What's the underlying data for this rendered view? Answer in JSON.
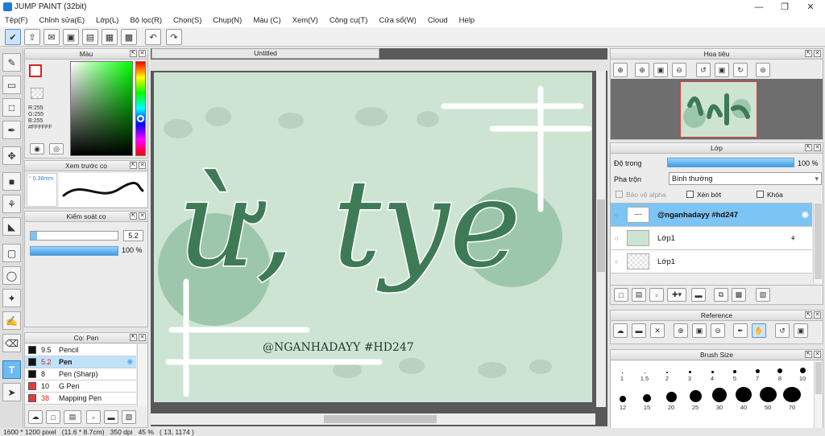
{
  "window": {
    "title": "JUMP PAINT (32bit)"
  },
  "menu": [
    "Tệp(F)",
    "Chỉnh sửa(E)",
    "Lớp(L)",
    "Bộ lọc(R)",
    "Chọn(S)",
    "Chụp(N)",
    "Màu (C)",
    "Xem(V)",
    "Công cụ(T)",
    "Cửa sổ(W)",
    "Cloud",
    "Help"
  ],
  "document": {
    "tab_title": "Untitled"
  },
  "color_panel": {
    "title": "Màu",
    "r": "R:255",
    "g": "G:255",
    "b": "B:255",
    "hex": "#FFFFFF"
  },
  "preview_panel": {
    "title": "Xem trước cọ",
    "size": "° 0.38mm"
  },
  "control_panel": {
    "title": "Kiểm soát cọ",
    "size_value": "5.2",
    "opacity_value": "100 %"
  },
  "brush_panel": {
    "title": "Cọ: Pen",
    "items": [
      {
        "size": "9.5",
        "name": "Pencil",
        "color": "#111111"
      },
      {
        "size": "5.2",
        "name": "Pen",
        "color": "#111111"
      },
      {
        "size": "8",
        "name": "Pen (Sharp)",
        "color": "#111111"
      },
      {
        "size": "10",
        "name": "G Pen",
        "color": "#e23b3b"
      },
      {
        "size": "38",
        "name": "Mapping Pen",
        "color": "#e23b3b"
      }
    ]
  },
  "navigator": {
    "title": "Hoa tiêu"
  },
  "layer_panel": {
    "title": "Lớp",
    "opacity_label": "Độ trong",
    "opacity_value": "100 %",
    "blend_label": "Pha trộn",
    "blend_value": "Bình thường",
    "protect_alpha": "Bảo vệ alpha",
    "clipping": "Xén bớt",
    "lock": "Khóa",
    "layers": [
      {
        "name": "@nganhadayy #hd247",
        "selected": true
      },
      {
        "name": "Lớp1",
        "selected": false
      },
      {
        "name": "Lớp1",
        "selected": false
      }
    ]
  },
  "reference_panel": {
    "title": "Reference"
  },
  "brush_size_panel": {
    "title": "Brush Size",
    "row1": [
      "1",
      "1.5",
      "2",
      "3",
      "4",
      "5",
      "7",
      "8",
      "10"
    ],
    "row2": [
      "12",
      "15",
      "20",
      "25",
      "30",
      "40",
      "50",
      "70"
    ]
  },
  "artwork": {
    "main": "ừ, tye",
    "tagline": "@NGANHADAYY #HD247"
  },
  "statusbar": {
    "text": "1600 * 1200 pixel   (11.6 * 8.7cm)   350 dpi   45 %   ( 13, 1174 )"
  },
  "colors": {
    "accent": "#6ebaf0",
    "canvas_bg": "#cde4d3",
    "art_green": "#3f7a57",
    "selection": "#7cc4f4"
  }
}
